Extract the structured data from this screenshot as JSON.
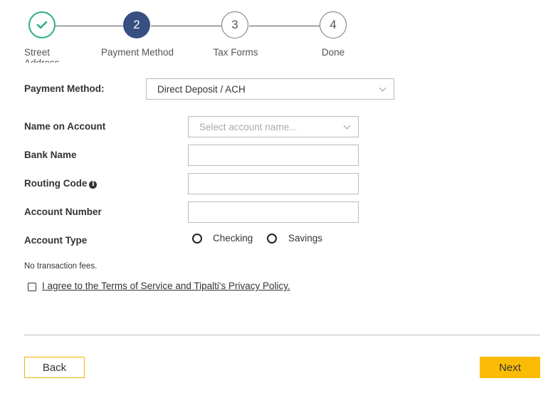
{
  "stepper": {
    "steps": [
      {
        "number": "",
        "label": "Street Address",
        "state": "done"
      },
      {
        "number": "2",
        "label": "Payment Method",
        "state": "active"
      },
      {
        "number": "3",
        "label": "Tax Forms",
        "state": "todo"
      },
      {
        "number": "4",
        "label": "Done",
        "state": "todo"
      }
    ],
    "done_icon": "checkmark-icon",
    "colors": {
      "done": "#2ab27b",
      "active": "#384f82"
    }
  },
  "form": {
    "payment_method_label": "Payment Method:",
    "payment_method_value": "Direct Deposit / ACH",
    "name_on_account_label": "Name on Account",
    "name_on_account_placeholder": "Select account name...",
    "bank_name_label": "Bank Name",
    "bank_name_value": "",
    "routing_code_label": "Routing Code",
    "routing_code_info_icon": "info-icon",
    "routing_code_value": "",
    "account_number_label": "Account Number",
    "account_number_value": "",
    "account_type_label": "Account Type",
    "account_type_options": [
      "Checking",
      "Savings"
    ],
    "fees_note": "No transaction fees.",
    "agree_text": "I agree to the Terms of Service and Tipalti's Privacy Policy.",
    "agree_checked": false
  },
  "footer": {
    "back_label": "Back",
    "next_label": "Next",
    "accent_color": "#fbbc05"
  }
}
